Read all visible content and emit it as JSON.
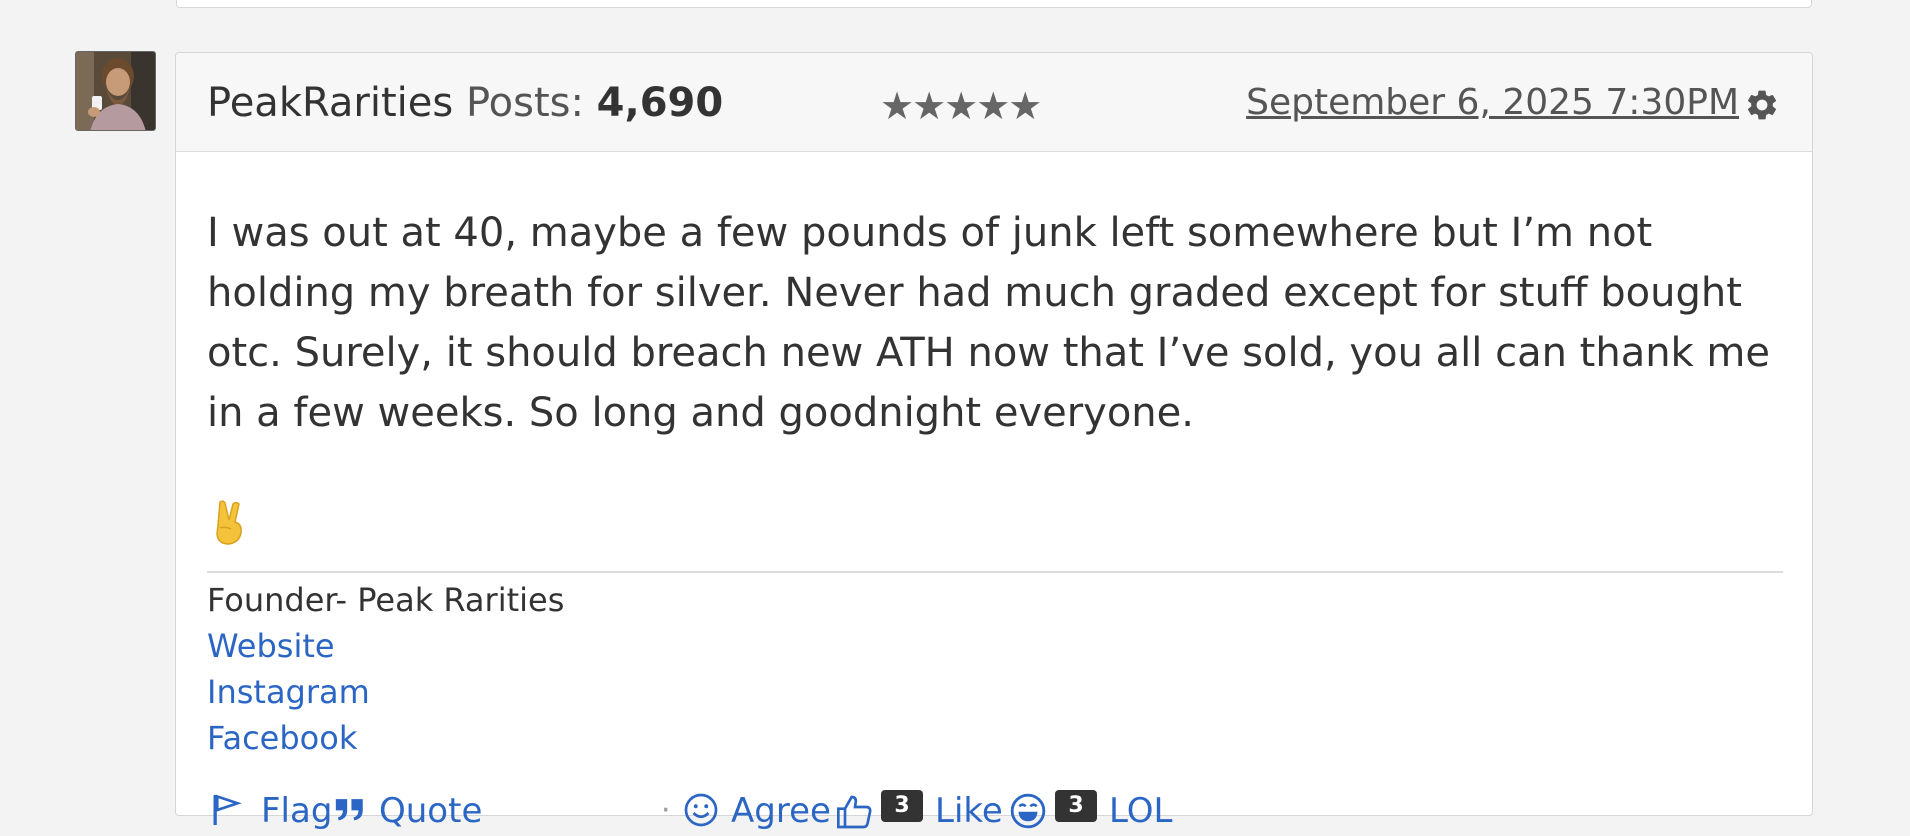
{
  "post": {
    "author": "PeakRarities",
    "posts_label": "Posts:",
    "posts_count": "4,690",
    "stars": "★★★★★",
    "date": "September 6, 2025 7:30PM",
    "body": "I was out at 40, maybe a few pounds of junk left somewhere but I’m not holding my breath for silver. Never had much graded except for stuff bought otc. Surely, it should breach new ATH now that I’ve sold, you all can thank me in a few weeks. So long and goodnight everyone.",
    "emoji": "victory-hand-emoji"
  },
  "signature": {
    "title": "Founder- Peak Rarities",
    "links": [
      "Website",
      "Instagram",
      "Facebook"
    ]
  },
  "reactions": {
    "flag": "Flag",
    "quote": "Quote",
    "separator": "·",
    "agree": "Agree",
    "like": "Like",
    "like_count": "3",
    "lol": "LOL",
    "lol_count": "3"
  },
  "colors": {
    "link": "#2b66c4",
    "text": "#333333",
    "background": "#f3f3f3"
  }
}
